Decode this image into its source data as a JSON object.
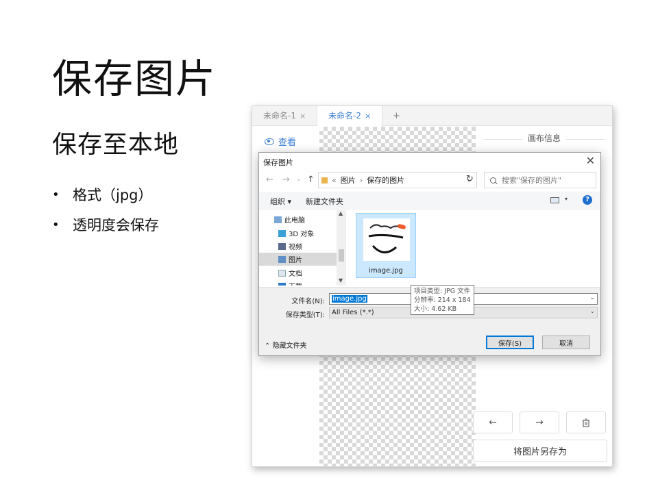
{
  "slide": {
    "title": "保存图片",
    "subtitle": "保存至本地",
    "bullets": [
      "格式（jpg）",
      "透明度会保存"
    ]
  },
  "app": {
    "tabs": [
      {
        "label": "未命名-1",
        "close": "×",
        "active": false
      },
      {
        "label": "未命名-2",
        "close": "×",
        "active": true
      }
    ],
    "tab_add": "+",
    "view_label": "查看",
    "panel_title": "画布信息",
    "nav_prev": "←",
    "nav_next": "→",
    "delete_icon": "trash-icon",
    "save_as_label": "将图片另存为",
    "accent_color": "#3b7fd4"
  },
  "dialog": {
    "title": "保存图片",
    "close": "✕",
    "breadcrumb": {
      "prefix": "«",
      "items": [
        "图片",
        "保存的图片"
      ],
      "separator": "›"
    },
    "search_placeholder": "搜索\"保存的图片\"",
    "toolbar": {
      "organize": "组织 ▾",
      "new_folder": "新建文件夹",
      "help": "?"
    },
    "tree": [
      {
        "label": "此电脑",
        "icon": "computer-icon",
        "selected": false
      },
      {
        "label": "3D 对象",
        "icon": "cube-icon",
        "selected": false
      },
      {
        "label": "视频",
        "icon": "video-icon",
        "selected": false
      },
      {
        "label": "图片",
        "icon": "pictures-icon",
        "selected": true
      },
      {
        "label": "文档",
        "icon": "document-icon",
        "selected": false
      },
      {
        "label": "下载",
        "icon": "download-icon",
        "selected": false
      }
    ],
    "file": {
      "name": "image.jpg"
    },
    "tooltip": {
      "type": "项目类型: JPG 文件",
      "resolution": "分辨率: 214 x 184",
      "size": "大小: 4.62 KB"
    },
    "filename_label": "文件名(N):",
    "filename_value": "image.jpg",
    "filetype_label": "保存类型(T):",
    "filetype_value": "All Files (*.*)",
    "hide_folders": "隐藏文件夹",
    "save_button": "保存(S)",
    "cancel_button": "取消"
  }
}
